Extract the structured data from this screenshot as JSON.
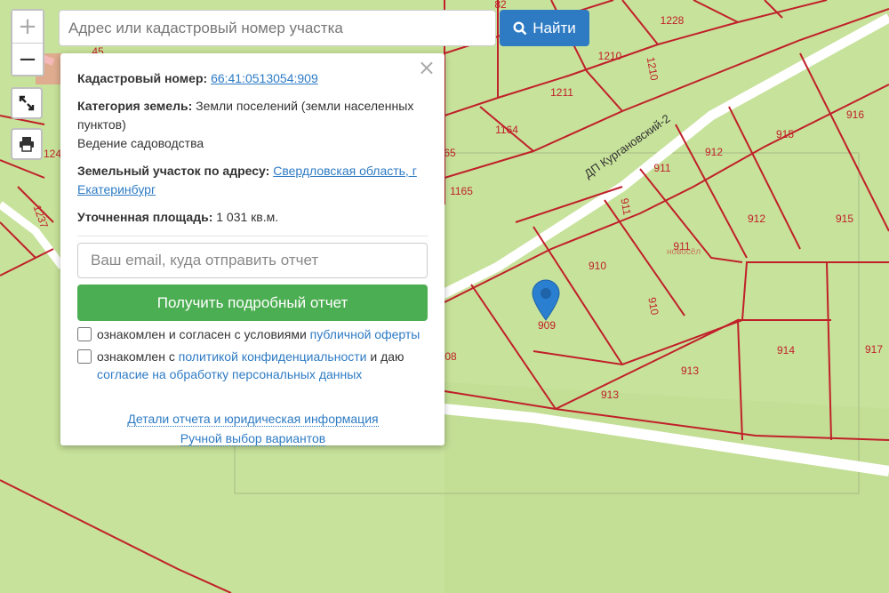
{
  "map": {
    "parcel_labels": [
      {
        "text": "82"
      },
      {
        "text": "1228"
      },
      {
        "text": "1210"
      },
      {
        "text": "1210"
      },
      {
        "text": "1211"
      },
      {
        "text": "1164"
      },
      {
        "text": "916"
      },
      {
        "text": "915"
      },
      {
        "text": "912"
      },
      {
        "text": "911"
      },
      {
        "text": "1165"
      },
      {
        "text": "65"
      },
      {
        "text": "911"
      },
      {
        "text": "912"
      },
      {
        "text": "915"
      },
      {
        "text": "911"
      },
      {
        "text": "910"
      },
      {
        "text": "910"
      },
      {
        "text": "909"
      },
      {
        "text": "914"
      },
      {
        "text": "917"
      },
      {
        "text": "913"
      },
      {
        "text": "913"
      },
      {
        "text": "08"
      },
      {
        "text": "1237"
      },
      {
        "text": "124"
      },
      {
        "text": "45"
      }
    ],
    "street_label": "ДП Кургановский-2",
    "watermark": "новосёл"
  },
  "controls": {
    "zoom_in": "+",
    "zoom_out": "−"
  },
  "search": {
    "placeholder": "Адрес или кадастровый номер участка",
    "value": "",
    "button_label": "Найти"
  },
  "popup": {
    "close": "×",
    "cadastral_label": "Кадастровый номер:",
    "cadastral_value": "66:41:0513054:909",
    "category_label": "Категория земель:",
    "category_value": "Земли поселений (земли населенных пунктов)",
    "usage": "Ведение садоводства",
    "address_label": "Земельный участок по адресу:",
    "address_value": "Свердловская область, г Екатеринбург",
    "area_label": "Уточненная площадь:",
    "area_value": "1 031 кв.м.",
    "email_placeholder": "Ваш email, куда отправить отчет",
    "report_button": "Получить подробный отчет",
    "agree1_text": "ознакомлен и согласен с условиями ",
    "agree1_link": "публичной оферты",
    "agree2_text": "ознакомлен с ",
    "agree2_link": "политикой конфиденциальности",
    "agree2_mid": " и даю ",
    "agree2_link2": "согласие на обработку персональных данных",
    "details_link": "Детали отчета и юридическая информация",
    "manual_link": "Ручной выбор вариантов"
  },
  "colors": {
    "map_bg": "#c7e29a",
    "parcel_line": "#c0202a",
    "road": "#ffffff",
    "accent_blue": "#2e7bc4",
    "accent_green": "#4cae52",
    "pin": "#2a7fd0"
  }
}
